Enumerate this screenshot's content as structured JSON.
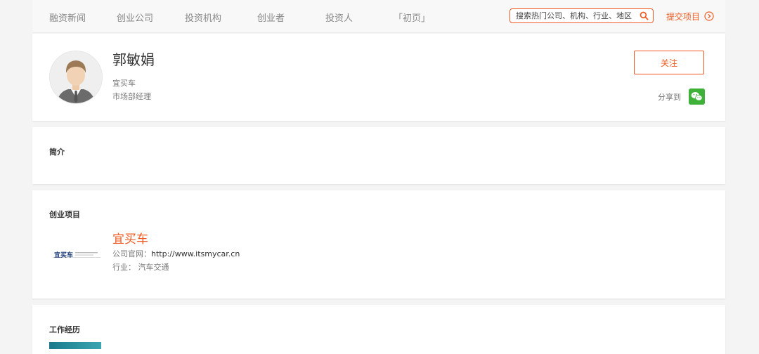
{
  "nav": {
    "items": [
      "融资新闻",
      "创业公司",
      "投资机构",
      "创业者",
      "投资人",
      "「初页」"
    ],
    "search_placeholder": "搜索热门公司、机构、行业、地区",
    "submit_label": "提交项目"
  },
  "profile": {
    "name": "郭敏娟",
    "company": "宜买车",
    "position": "市场部经理",
    "follow_label": "关注",
    "share_label": "分享到"
  },
  "intro": {
    "title": "简介"
  },
  "projects": {
    "title": "创业项目",
    "items": [
      {
        "name": "宜买车",
        "logo_text": "宜买车",
        "site_label": "公司官网：",
        "site_url": "http://www.itsmycar.cn",
        "industry_label": "行业：",
        "industry_value": "汽车交通"
      }
    ]
  },
  "work": {
    "title": "工作经历"
  },
  "colors": {
    "accent": "#f05a22",
    "wechat": "#3fb03a",
    "background": "#f4f4f4"
  },
  "icons": {
    "search": "search-icon",
    "submit": "chevron-right-circle-icon",
    "share": "wechat-icon",
    "avatar": "avatar"
  }
}
